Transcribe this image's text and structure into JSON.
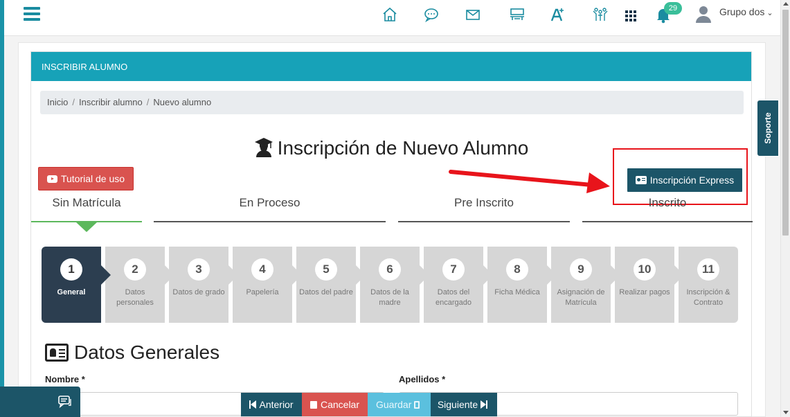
{
  "topbar": {
    "notification_count": "29",
    "user_name": "Grupo dos",
    "icons": [
      "home-icon",
      "chat-bubble-icon",
      "mail-icon",
      "classroom-icon",
      "font-plus-icon",
      "people-icon",
      "apps-grid-icon",
      "bell-icon",
      "user-avatar-icon"
    ]
  },
  "soporte_label": "Soporte",
  "card": {
    "header": "INSCRIBIR ALUMNO",
    "breadcrumb": [
      "Inicio",
      "Inscribir alumno",
      "Nuevo alumno"
    ],
    "title": "Inscripción de Nuevo Alumno",
    "tutorial_button": "Tutorial de uso",
    "express_button": "Inscripción Express"
  },
  "status_tabs": [
    {
      "label": "Sin Matrícula",
      "active": true
    },
    {
      "label": "En Proceso",
      "active": false
    },
    {
      "label": "Pre Inscrito",
      "active": false
    },
    {
      "label": "Inscrito",
      "active": false
    }
  ],
  "steps": [
    {
      "num": "1",
      "label": "General"
    },
    {
      "num": "2",
      "label": "Datos personales"
    },
    {
      "num": "3",
      "label": "Datos de grado"
    },
    {
      "num": "4",
      "label": "Papelería"
    },
    {
      "num": "5",
      "label": "Datos del padre"
    },
    {
      "num": "6",
      "label": "Datos de la madre"
    },
    {
      "num": "7",
      "label": "Datos del encargado"
    },
    {
      "num": "8",
      "label": "Ficha Médica"
    },
    {
      "num": "9",
      "label": "Asignación de Matrícula"
    },
    {
      "num": "10",
      "label": "Realizar pagos"
    },
    {
      "num": "11",
      "label": "Inscripción & Contrato"
    }
  ],
  "section": {
    "title": "Datos Generales",
    "nombre_label": "Nombre *",
    "apellidos_label": "Apellidos *"
  },
  "actions": {
    "prev": "Anterior",
    "cancel": "Cancelar",
    "save": "Guardar",
    "next": "Siguiente"
  },
  "colors": {
    "primary": "#1c5568",
    "header": "#17a2b8",
    "danger": "#d9534f",
    "info": "#5bc0de",
    "success": "#5cb85c",
    "annotation": "#e8141b"
  }
}
